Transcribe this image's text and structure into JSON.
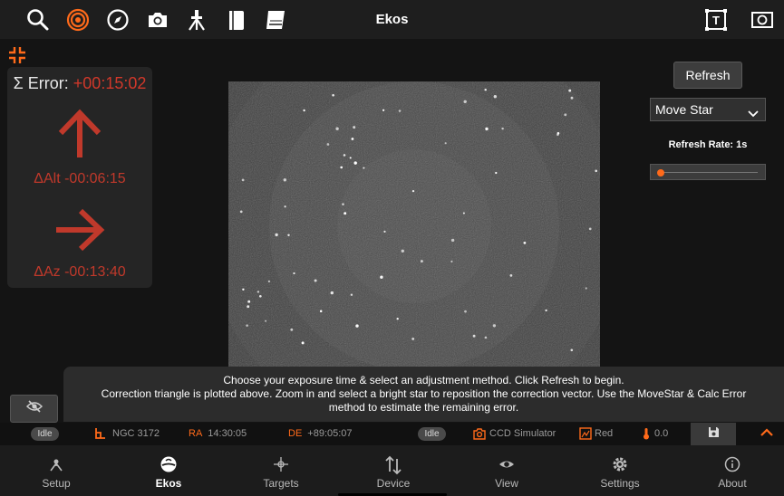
{
  "topbar": {
    "title": "Ekos",
    "icons": [
      "search-icon",
      "target-icon",
      "compass-icon",
      "camera-icon",
      "tripod-icon",
      "book-icon",
      "document-icon",
      "text-overlay-icon",
      "image-icon"
    ]
  },
  "error_panel": {
    "total_label": "Σ Error:",
    "total_value": "+00:15:02",
    "alt_value": "ΔAlt -00:06:15",
    "az_value": "ΔAz -00:13:40",
    "error_color": "#c0392b"
  },
  "controls": {
    "refresh_label": "Refresh",
    "method_selected": "Move Star",
    "refresh_rate_label": "Refresh Rate: 1s",
    "refresh_rate_fraction": 0.0
  },
  "message": {
    "line1": "Choose your exposure time & select an adjustment method. Click Refresh to begin.",
    "line2": "Correction triangle is plotted above. Zoom in and select a bright star to reposition the correction vector. Use the MoveStar & Calc Error",
    "line3": "method to estimate the remaining error."
  },
  "statusbar": {
    "mount_state": "Idle",
    "target": "NGC 3172",
    "ra_label": "RA",
    "ra_value": "14:30:05",
    "de_label": "DE",
    "de_value": "+89:05:07",
    "camera_state": "Idle",
    "camera": "CCD Simulator",
    "filter": "Red",
    "temperature": "0.0"
  },
  "nav": {
    "items": [
      {
        "label": "Setup",
        "icon": "setup-icon"
      },
      {
        "label": "Ekos",
        "icon": "ekos-icon"
      },
      {
        "label": "Targets",
        "icon": "targets-icon"
      },
      {
        "label": "Device",
        "icon": "device-icon"
      },
      {
        "label": "View",
        "icon": "view-icon"
      },
      {
        "label": "Settings",
        "icon": "settings-icon"
      },
      {
        "label": "About",
        "icon": "about-icon"
      }
    ],
    "active": "Ekos"
  },
  "colors": {
    "accent": "#ff6a1a",
    "error": "#c0392b"
  }
}
